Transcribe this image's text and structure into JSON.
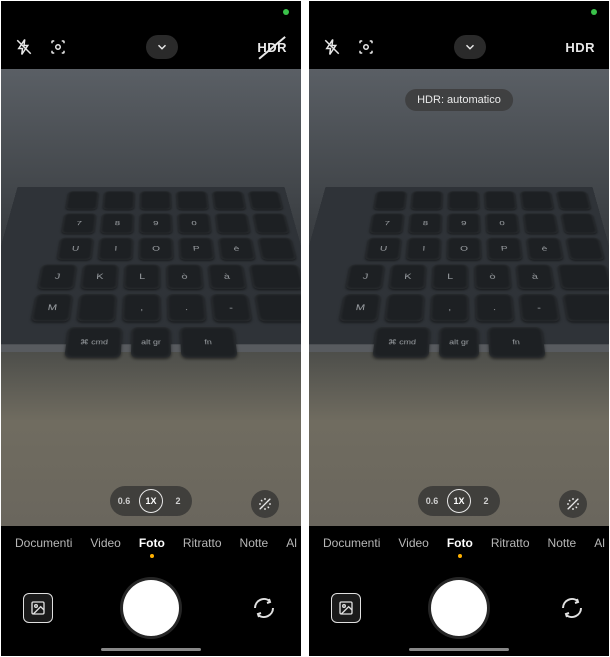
{
  "screens": [
    {
      "top": {
        "flash": "flash-off",
        "lens": "google-lens",
        "chevron": "expand",
        "hdr_label": "HDR",
        "hdr_state": "off"
      },
      "toast": null,
      "zoom": {
        "options": [
          "0.6",
          "1X",
          "2"
        ],
        "active_index": 1
      },
      "modes": {
        "items": [
          "Documenti",
          "Video",
          "Foto",
          "Ritratto",
          "Notte",
          "Al"
        ],
        "active_index": 2
      }
    },
    {
      "top": {
        "flash": "flash-off",
        "lens": "google-lens",
        "chevron": "expand",
        "hdr_label": "HDR",
        "hdr_state": "on"
      },
      "toast": "HDR: automatico",
      "zoom": {
        "options": [
          "0.6",
          "1X",
          "2"
        ],
        "active_index": 1
      },
      "modes": {
        "items": [
          "Documenti",
          "Video",
          "Foto",
          "Ritratto",
          "Notte",
          "Al"
        ],
        "active_index": 2
      }
    }
  ],
  "keyboard_rows": [
    [
      "",
      "",
      "",
      "",
      "",
      "",
      ""
    ],
    [
      "7",
      "8",
      "9",
      "0",
      "",
      "",
      ""
    ],
    [
      "U",
      "I",
      "O",
      "P",
      "è",
      "",
      ""
    ],
    [
      "J",
      "K",
      "L",
      "ò",
      "à",
      "",
      ""
    ],
    [
      "M",
      "",
      ",",
      ".",
      "-",
      "",
      ""
    ]
  ],
  "bottom_keys": {
    "cmd": "⌘\ncmd",
    "alt": "alt\ngr",
    "fn": "fn"
  }
}
